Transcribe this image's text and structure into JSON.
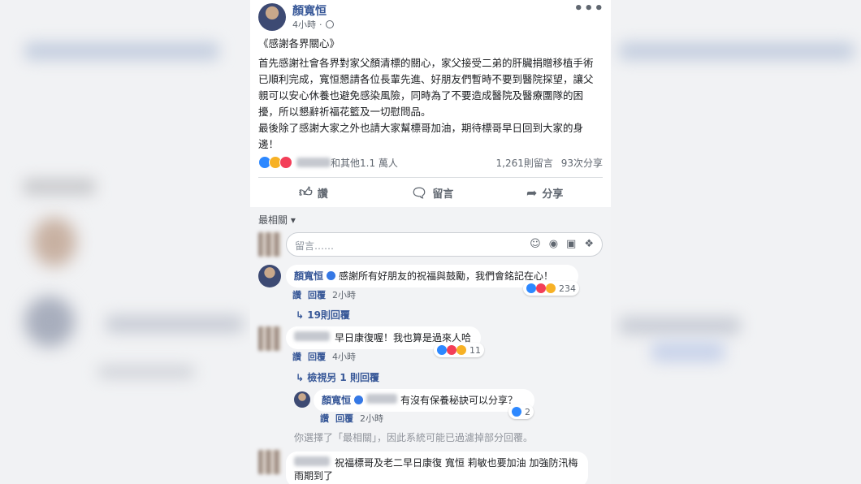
{
  "post": {
    "author": "顏寬恒",
    "time": "4小時",
    "title": "《感謝各界關心》",
    "paragraph1": "首先感謝社會各界對家父顏清標的關心，家父接受二弟的肝臟捐贈移植手術已順利完成，寬恒懇請各位長輩先進、好朋友們暫時不要到醫院探望，讓父親可以安心休養也避免感染風險，同時為了不要造成醫院及醫療團隊的困擾，所以懇辭祈福花籃及一切慰問品。",
    "paragraph2": "最後除了感謝大家之外也請大家幫標哥加油，期待標哥早日回到大家的身邊！",
    "reactions_text": "和其他1.1 萬人",
    "comments_count": "1,261則留言",
    "shares_count": "93次分享"
  },
  "actions": {
    "like": "讚",
    "comment": "留言",
    "share": "分享"
  },
  "comments_section": {
    "filter": "最相關 ▾",
    "input_placeholder": "留言……",
    "filter_note": "你選擇了「最相關」，因此系統可能已過濾掉部分回覆。"
  },
  "comments": [
    {
      "author": "顏寬恒",
      "text": "感謝所有好朋友的祝福與鼓勵，我們會銘記在心！",
      "like": "讚",
      "reply": "回覆",
      "time": "2小時",
      "reaction_count": "234",
      "replies_link": "↳ 19則回覆"
    },
    {
      "text": "早日康復喔！我也算是過來人哈",
      "like": "讚",
      "reply": "回覆",
      "time": "4小時",
      "reaction_count": "11",
      "replies_link": "↳ 檢視另 1 則回覆"
    },
    {
      "author": "顏寬恒",
      "text": "有沒有保養秘訣可以分享？",
      "like": "讚",
      "reply": "回覆",
      "time": "2小時",
      "reaction_count": "2"
    },
    {
      "text": "祝福標哥及老二早日康復 寬恒 莉敏也要加油 加強防汛梅雨期到了"
    }
  ],
  "colors": {
    "link_blue": "#385898",
    "comments_bg": "#f2f3f5",
    "like_blue": "#2d88ff",
    "love_red": "#f33e58",
    "haha_yellow": "#f7b125"
  }
}
